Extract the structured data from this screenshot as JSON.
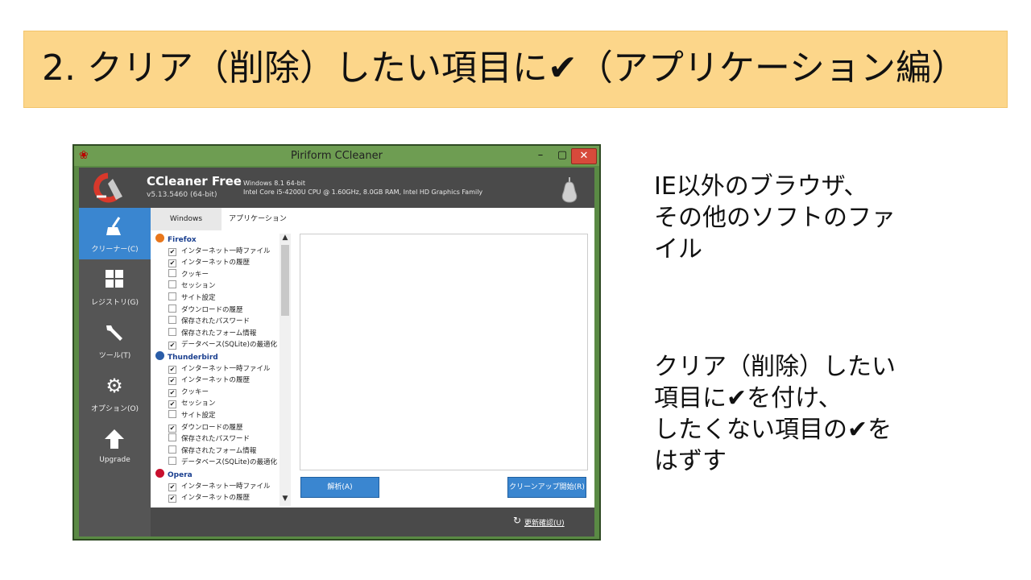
{
  "slide": {
    "title": "2.  クリア（削除）したい項目に✔（アプリケーション編）",
    "side_text_1": "IE以外のブラウザ、\nその他のソフトのファ\nイル",
    "side_text_2": "クリア（削除）したい\n項目に✔を付け、\nしたくない項目の✔を\nはずす"
  },
  "window": {
    "title": "Piriform CCleaner",
    "min_label": "–",
    "max_label": "▢",
    "close_label": "✕"
  },
  "header": {
    "product_name": "CCleaner Free",
    "version": "v5.13.5460 (64-bit)",
    "os": "Windows 8.1 64-bit",
    "hardware": "Intel Core i5-4200U CPU @ 1.60GHz, 8.0GB RAM, Intel HD Graphics Family"
  },
  "sidebar": {
    "items": [
      {
        "label": "クリーナー(C)",
        "icon": "broom-icon"
      },
      {
        "label": "レジストリ(G)",
        "icon": "grid-icon"
      },
      {
        "label": "ツール(T)",
        "icon": "wrench-icon"
      },
      {
        "label": "オプション(O)",
        "icon": "gear-icon"
      },
      {
        "label": "Upgrade",
        "icon": "arrow-up-icon"
      }
    ]
  },
  "tabs": {
    "windows": "Windows",
    "applications": "アプリケーション"
  },
  "groups": [
    {
      "name": "Firefox",
      "color": "#e8771d",
      "items": [
        {
          "label": "インターネット一時ファイル",
          "checked": true
        },
        {
          "label": "インターネットの履歴",
          "checked": true
        },
        {
          "label": "クッキー",
          "checked": false
        },
        {
          "label": "セッション",
          "checked": false
        },
        {
          "label": "サイト設定",
          "checked": false
        },
        {
          "label": "ダウンロードの履歴",
          "checked": false
        },
        {
          "label": "保存されたパスワード",
          "checked": false
        },
        {
          "label": "保存されたフォーム情報",
          "checked": false
        },
        {
          "label": "データベース(SQLite)の最適化",
          "checked": true
        }
      ]
    },
    {
      "name": "Thunderbird",
      "color": "#2a5da8",
      "items": [
        {
          "label": "インターネット一時ファイル",
          "checked": true
        },
        {
          "label": "インターネットの履歴",
          "checked": true
        },
        {
          "label": "クッキー",
          "checked": true
        },
        {
          "label": "セッション",
          "checked": true
        },
        {
          "label": "サイト設定",
          "checked": false
        },
        {
          "label": "ダウンロードの履歴",
          "checked": true
        },
        {
          "label": "保存されたパスワード",
          "checked": false
        },
        {
          "label": "保存されたフォーム情報",
          "checked": false
        },
        {
          "label": "データベース(SQLite)の最適化",
          "checked": false
        }
      ]
    },
    {
      "name": "Opera",
      "color": "#c8102e",
      "items": [
        {
          "label": "インターネット一時ファイル",
          "checked": true
        },
        {
          "label": "インターネットの履歴",
          "checked": true
        }
      ]
    }
  ],
  "buttons": {
    "analyze": "解析(A)",
    "clean": "クリーンアップ開始(R)"
  },
  "footer": {
    "update_link": "更新確認(U)"
  },
  "colors": {
    "accent": "#3a86d0",
    "banner": "#fcd68a"
  }
}
